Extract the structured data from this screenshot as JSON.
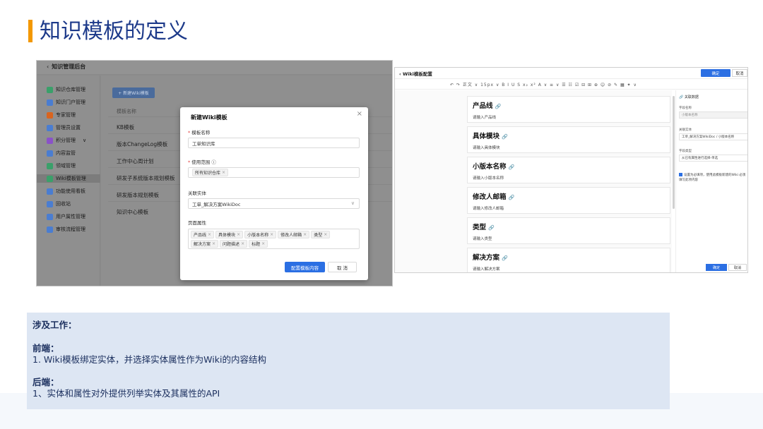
{
  "slide": {
    "title": "知识模板的定义"
  },
  "left_shot": {
    "back_label": "知识管理后台",
    "nav": [
      {
        "label": "知识仓库管理",
        "icon": "knowledge-repo-icon",
        "color": "#3aa06a"
      },
      {
        "label": "知识门户管理",
        "icon": "portal-icon",
        "color": "#4a7dd1"
      },
      {
        "label": "专家管理",
        "icon": "expert-icon",
        "color": "#d9641f"
      },
      {
        "label": "管理员设置",
        "icon": "admin-icon",
        "color": "#4a7dd1"
      },
      {
        "label": "积分管理",
        "icon": "points-icon",
        "color": "#8a52c8"
      },
      {
        "label": "内容监管",
        "icon": "content-monitor-icon",
        "color": "#4a7dd1"
      },
      {
        "label": "领域管理",
        "icon": "domain-icon",
        "color": "#3aa06a"
      },
      {
        "label": "Wiki模板管理",
        "icon": "wiki-template-icon",
        "color": "#3aa06a"
      },
      {
        "label": "功能使用看板",
        "icon": "dashboard-icon",
        "color": "#4a7dd1"
      },
      {
        "label": "回收站",
        "icon": "recycle-icon",
        "color": "#4a7dd1"
      },
      {
        "label": "用户属性管理",
        "icon": "user-attr-icon",
        "color": "#4a7dd1"
      },
      {
        "label": "审核流程管理",
        "icon": "review-flow-icon",
        "color": "#4a7dd1"
      }
    ],
    "points_chevron": "∨",
    "new_button": "+ 新建Wiki模板",
    "column_header": "模板名称",
    "rows": [
      "KB模板",
      "版本ChangeLog模板",
      "工作中心周计划",
      "研发子系统版本规划模板",
      "研发版本规划模板",
      "知识中心模板"
    ],
    "modal": {
      "title": "新建Wiki模板",
      "name_label": "模板名称",
      "name_value": "工单知识库",
      "scope_label": "使用范围",
      "scope_tag": "所有知识仓库",
      "entity_label": "关联实体",
      "entity_value": "工单_解决方案WikiDoc",
      "attrs_label": "页面属性",
      "attrs": [
        "产品线",
        "具体模块",
        "小版本名称",
        "修改人邮箱",
        "类型",
        "解决方案",
        "问题描述",
        "标题"
      ],
      "primary_button": "配置模板内容",
      "cancel_button": "取 消"
    }
  },
  "right_shot": {
    "back_label": "Wiki模板配置",
    "ok_button": "确定",
    "cancel_button": "取消",
    "toolbar_text": "↶ ↷  正文 ∨  15px ∨  B  I  U  S  x₂  x²  A ∨  ≡ ∨  ☰  ☷  ☑  ⊟  ⊞  ⊕  ☺  ⊘  ✎  ▦  ✦ ∨",
    "blocks": [
      {
        "title": "产品线",
        "hint": "请输入产品线"
      },
      {
        "title": "具体模块",
        "hint": "请输入具体模块"
      },
      {
        "title": "小版本名称",
        "hint": "请输入小版本名称"
      },
      {
        "title": "修改人邮箱",
        "hint": "请输入修改人邮箱"
      },
      {
        "title": "类型",
        "hint": "请输入类型"
      },
      {
        "title": "解决方案",
        "hint": "请输入解决方案"
      }
    ],
    "panel": {
      "header": "关联数据",
      "field_name_label": "字段名称",
      "field_name_value": "小版本名称",
      "entity_label": "关联实体",
      "entity_value": "工单_解决方案WikiDoc / 小版本名称",
      "field_type_label": "字段类型",
      "field_type_value": "从已有属性进行选择-单选",
      "check_text": "设置为必填项，使用此模板新建的Wiki 必须填写此项内容",
      "ok_button": "确定",
      "cancel_button": "取消"
    }
  },
  "notes": {
    "heading": "涉及工作：",
    "frontend_label": "前端：",
    "frontend_item": "1. Wiki模板绑定实体，并选择实体属性作为Wiki的内容结构",
    "backend_label": "后端：",
    "backend_item": "1、实体和属性对外提供列举实体及其属性的API"
  },
  "colors": {
    "title": "#1d3a8a",
    "accent": "#f39800",
    "primary": "#2b6fe3",
    "notes_bg": "#dde6f3"
  }
}
